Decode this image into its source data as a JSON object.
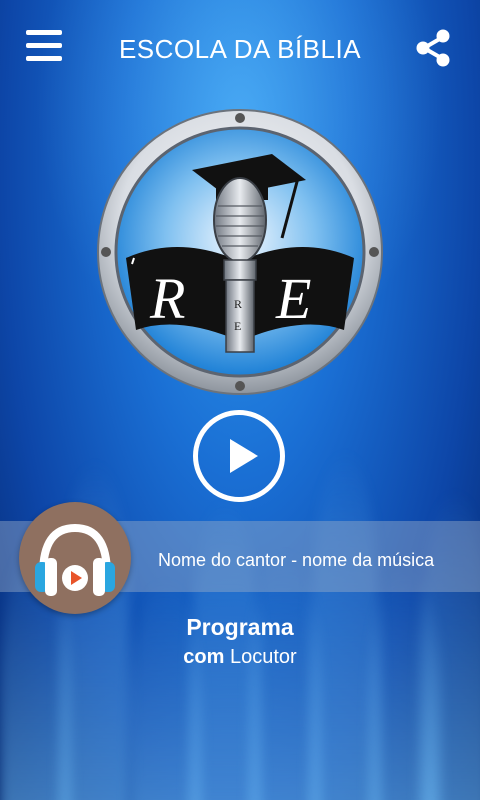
{
  "header": {
    "title": "ESCOLA DA BÍBLIA",
    "menu_icon": "hamburger-menu-icon",
    "share_icon": "share-icon"
  },
  "logo": {
    "letters": [
      "R",
      "E"
    ],
    "icon": "microphone-graduation-cap-logo"
  },
  "player": {
    "play_icon": "play-icon",
    "track": "Nome do cantor - nome da música",
    "avatar_icon": "headphones-icon"
  },
  "program": {
    "title": "Programa",
    "sub_prefix": "com",
    "host": "Locutor"
  },
  "colors": {
    "bg_top": "#2f9bf0",
    "bg_bottom": "#06286e",
    "avatar_bg": "#8f7060",
    "headphone_blue": "#2aa6e0",
    "headphone_white": "#ffffff",
    "play_orange": "#e8542a"
  }
}
